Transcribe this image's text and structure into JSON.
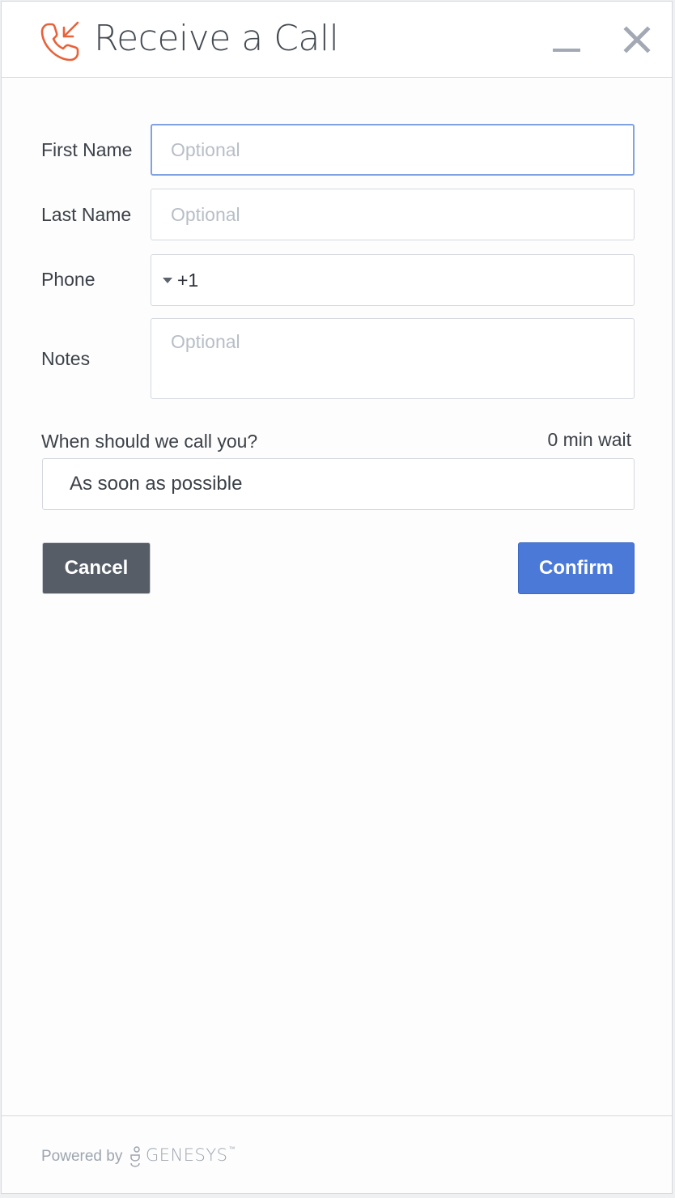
{
  "window": {
    "title": "Receive a Call",
    "title_icon": "incoming-call-icon",
    "minimize_icon": "minimize-icon",
    "close_icon": "close-icon"
  },
  "form": {
    "first_name": {
      "label": "First Name",
      "placeholder": "Optional",
      "value": ""
    },
    "last_name": {
      "label": "Last Name",
      "placeholder": "Optional",
      "value": ""
    },
    "phone": {
      "label": "Phone",
      "value": "+1",
      "country_icon": "caret-down-icon"
    },
    "notes": {
      "label": "Notes",
      "placeholder": "Optional",
      "value": ""
    },
    "schedule": {
      "question": "When should we call you?",
      "wait": "0 min wait",
      "selected": "As soon as possible"
    }
  },
  "actions": {
    "cancel_label": "Cancel",
    "confirm_label": "Confirm"
  },
  "footer": {
    "powered_by": "Powered by",
    "brand": "GENESYS",
    "brand_mark": "™"
  },
  "colors": {
    "accent": "#4a79d8",
    "icon_orange": "#e8623a",
    "cancel_bg": "#575d66",
    "focus_border": "#7ea3e0"
  }
}
